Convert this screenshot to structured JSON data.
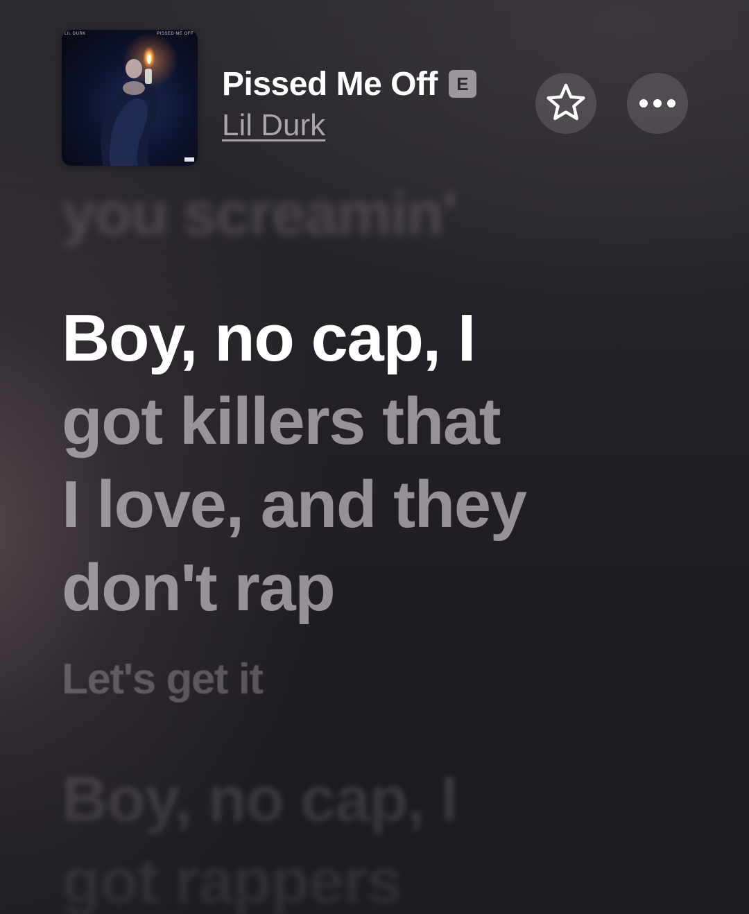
{
  "now_playing": {
    "artwork": {
      "artist_text": "LIL DURK",
      "title_text": "PISSED ME OFF"
    },
    "title": "Pissed Me Off",
    "explicit_badge": "E",
    "artist": "Lil Durk"
  },
  "controls": {
    "favorite_icon": "star-outline-icon",
    "more_icon": "ellipsis-icon"
  },
  "lyrics": {
    "previous_line": "you screamin'",
    "active_line": {
      "sung": "Boy, no cap, I",
      "rest_lines": [
        "got killers that",
        "I love, and they",
        "don't rap"
      ]
    },
    "next_line": "Let's get it",
    "following_line": [
      "Boy, no cap, I",
      "got rappers"
    ]
  },
  "colors": {
    "active_text": "#ffffff",
    "dim_text": "#c4bec3",
    "background": "#1c1b20"
  }
}
